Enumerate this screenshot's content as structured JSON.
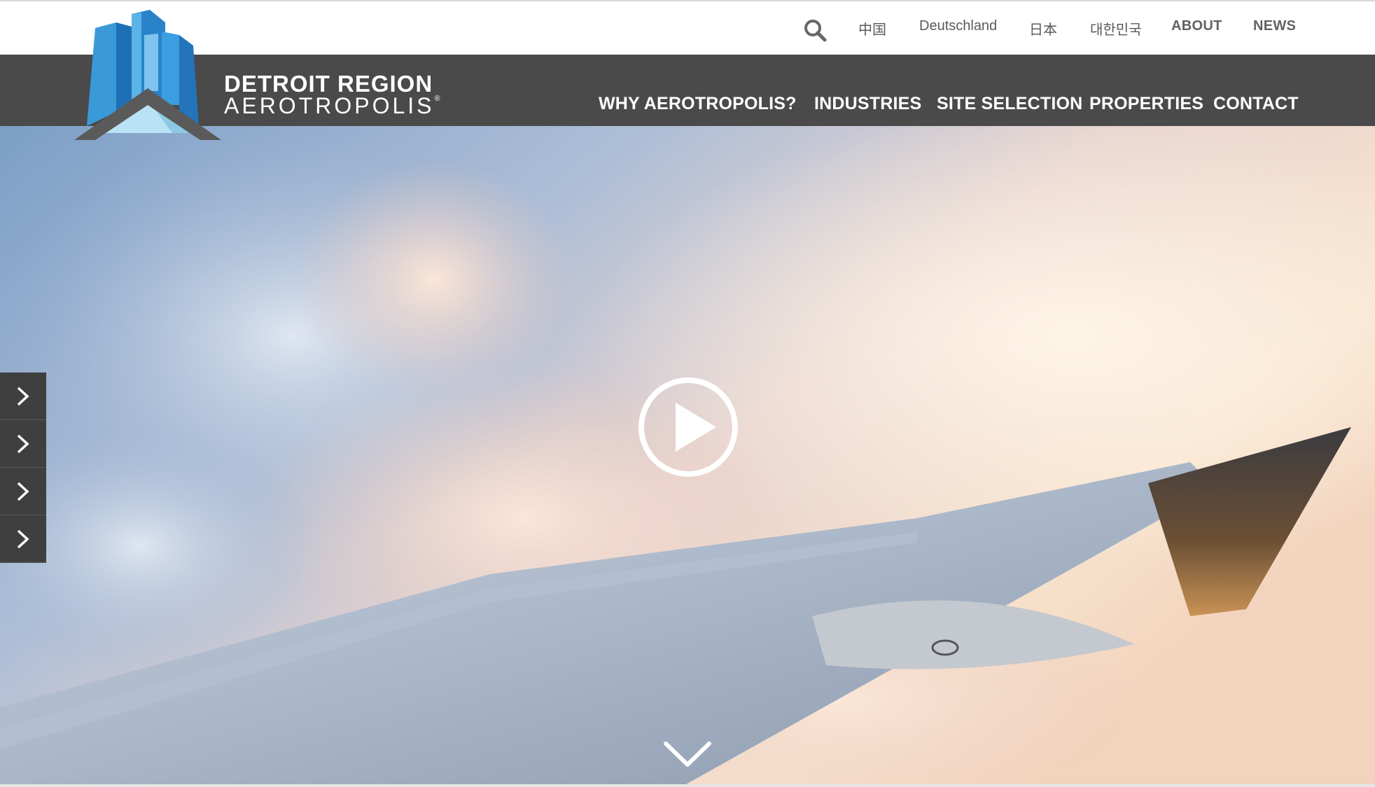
{
  "utility_nav": {
    "search_icon": "search-icon",
    "items": [
      {
        "label": "中国"
      },
      {
        "label": "Deutschland"
      },
      {
        "label": "日本"
      },
      {
        "label": "대한민국"
      },
      {
        "label": "ABOUT"
      },
      {
        "label": "NEWS"
      }
    ]
  },
  "logo": {
    "line1": "DETROIT REGION",
    "line2": "AEROTROPOLIS",
    "registered": "®"
  },
  "main_nav": {
    "items": [
      {
        "label": "WHY AEROTROPOLIS?"
      },
      {
        "label": "INDUSTRIES"
      },
      {
        "label": "SITE SELECTION"
      },
      {
        "label": "PROPERTIES"
      },
      {
        "label": "CONTACT"
      }
    ]
  },
  "hero": {
    "side_tabs": [
      "chevron-right-icon",
      "chevron-right-icon",
      "chevron-right-icon",
      "chevron-right-icon"
    ],
    "play_icon": "play-icon",
    "scroll_icon": "chevron-down-icon"
  },
  "colors": {
    "nav_bg": "#4a4a4a",
    "side_tab_bg": "#3f3f3f",
    "logo_blue": "#2f8fd4",
    "logo_light": "#a8d8ef",
    "utility_text": "#5a5a5a"
  }
}
